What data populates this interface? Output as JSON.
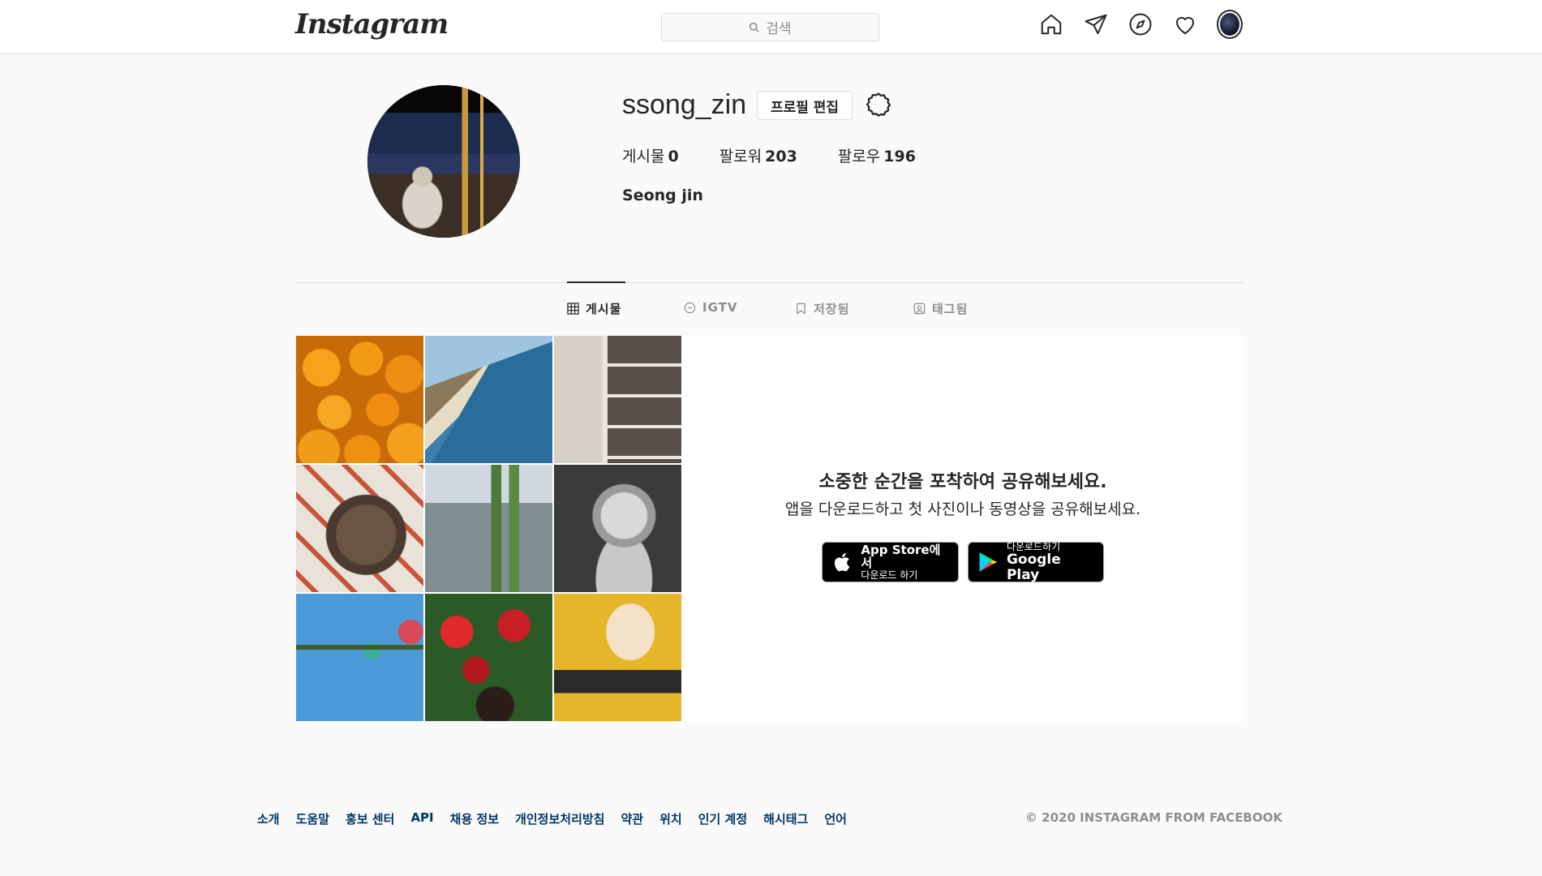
{
  "header": {
    "logo": "Instagram",
    "search_placeholder": "검색"
  },
  "profile": {
    "username": "ssong_zin",
    "edit_button": "프로필 편집",
    "stats": [
      {
        "label": "게시물",
        "value": "0"
      },
      {
        "label": "팔로워",
        "value": "203"
      },
      {
        "label": "팔로우",
        "value": "196"
      }
    ],
    "full_name": "Seong jin"
  },
  "tabs": [
    {
      "label": "게시물",
      "icon": "grid-icon",
      "active": true
    },
    {
      "label": "IGTV",
      "icon": "igtv-icon",
      "active": false
    },
    {
      "label": "저장됨",
      "icon": "bookmark-icon",
      "active": false
    },
    {
      "label": "태그됨",
      "icon": "tagged-icon",
      "active": false
    }
  ],
  "promo": {
    "title": "소중한 순간을 포착하여 공유해보세요.",
    "subtitle": "앱을 다운로드하고 첫 사진이나 동영상을 공유해보세요.",
    "app_store": {
      "line1": "App Store에서",
      "line2": "다운로드 하기"
    },
    "google_play": {
      "line1": "다운로드하기",
      "line2": "Google Play"
    }
  },
  "footer": {
    "links": [
      "소개",
      "도움말",
      "홍보 센터",
      "API",
      "채용 정보",
      "개인정보처리방침",
      "약관",
      "위치",
      "인기 계정",
      "해시태그",
      "언어"
    ],
    "copyright": "© 2020 INSTAGRAM FROM FACEBOOK"
  }
}
